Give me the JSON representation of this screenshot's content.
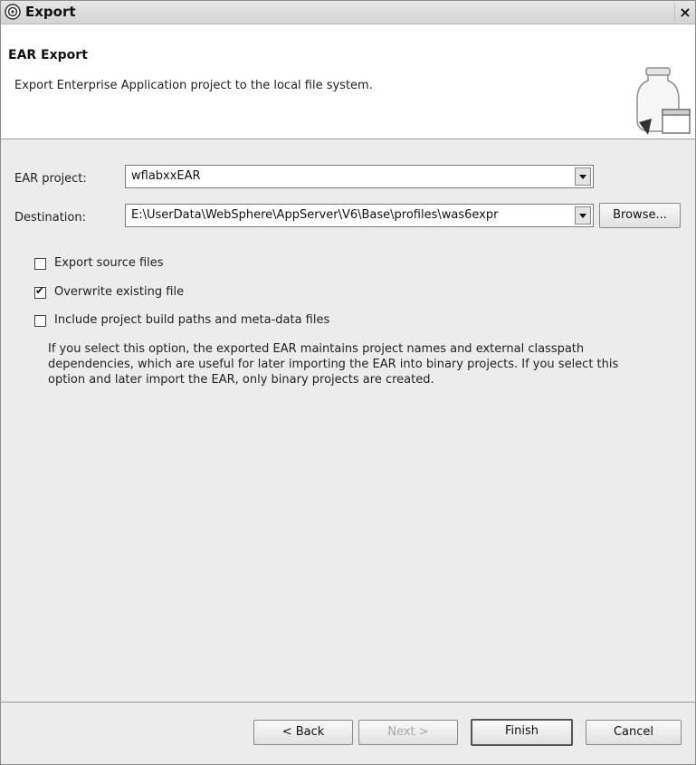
{
  "window": {
    "title": "Export",
    "close_glyph": "×",
    "icon": "eclipse-icon"
  },
  "banner": {
    "title": "EAR Export",
    "description": "Export Enterprise Application project to the local file system.",
    "art_icon": "export-jar-icon"
  },
  "form": {
    "ear_project_label": "EAR project:",
    "ear_project_value": "wflabxxEAR",
    "destination_label": "Destination:",
    "destination_value": "E:\\UserData\\WebSphere\\AppServer\\V6\\Base\\profiles\\was6expr",
    "browse_label": "Browse..."
  },
  "options": [
    {
      "label": "Export source files",
      "checked": false
    },
    {
      "label": "Overwrite existing file",
      "checked": true
    },
    {
      "label": "Include project build paths and meta-data files",
      "checked": false
    }
  ],
  "help_text": "If you select this option, the exported EAR maintains project names and external classpath dependencies, which are useful for later importing the EAR into binary projects. If you select this option and later import the EAR, only binary projects are created.",
  "buttons": {
    "back": "< Back",
    "next": "Next >",
    "finish": "Finish",
    "cancel": "Cancel"
  }
}
